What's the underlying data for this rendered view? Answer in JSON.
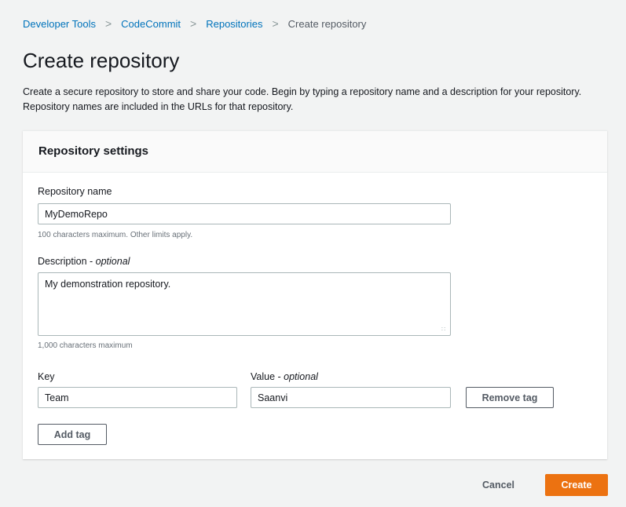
{
  "breadcrumb": {
    "items": [
      "Developer Tools",
      "CodeCommit",
      "Repositories"
    ],
    "current": "Create repository",
    "separator": ">"
  },
  "page": {
    "title": "Create repository",
    "description": "Create a secure repository to store and share your code. Begin by typing a repository name and a description for your repository. Repository names are included in the URLs for that repository."
  },
  "settings": {
    "title": "Repository settings",
    "name_label": "Repository name",
    "name_value": "MyDemoRepo",
    "name_hint": "100 characters maximum. Other limits apply.",
    "description_label": "Description",
    "description_optional": "optional",
    "description_value": "My demonstration repository.",
    "description_hint": "1,000 characters maximum"
  },
  "tags": {
    "key_label": "Key",
    "value_label": "Value",
    "value_optional": "optional",
    "key_value": "Team",
    "value_value": "Saanvi",
    "remove_label": "Remove tag",
    "add_label": "Add tag"
  },
  "footer": {
    "cancel_label": "Cancel",
    "create_label": "Create"
  },
  "colors": {
    "link": "#0073bb",
    "primary": "#ec7211",
    "background": "#f2f3f3"
  }
}
